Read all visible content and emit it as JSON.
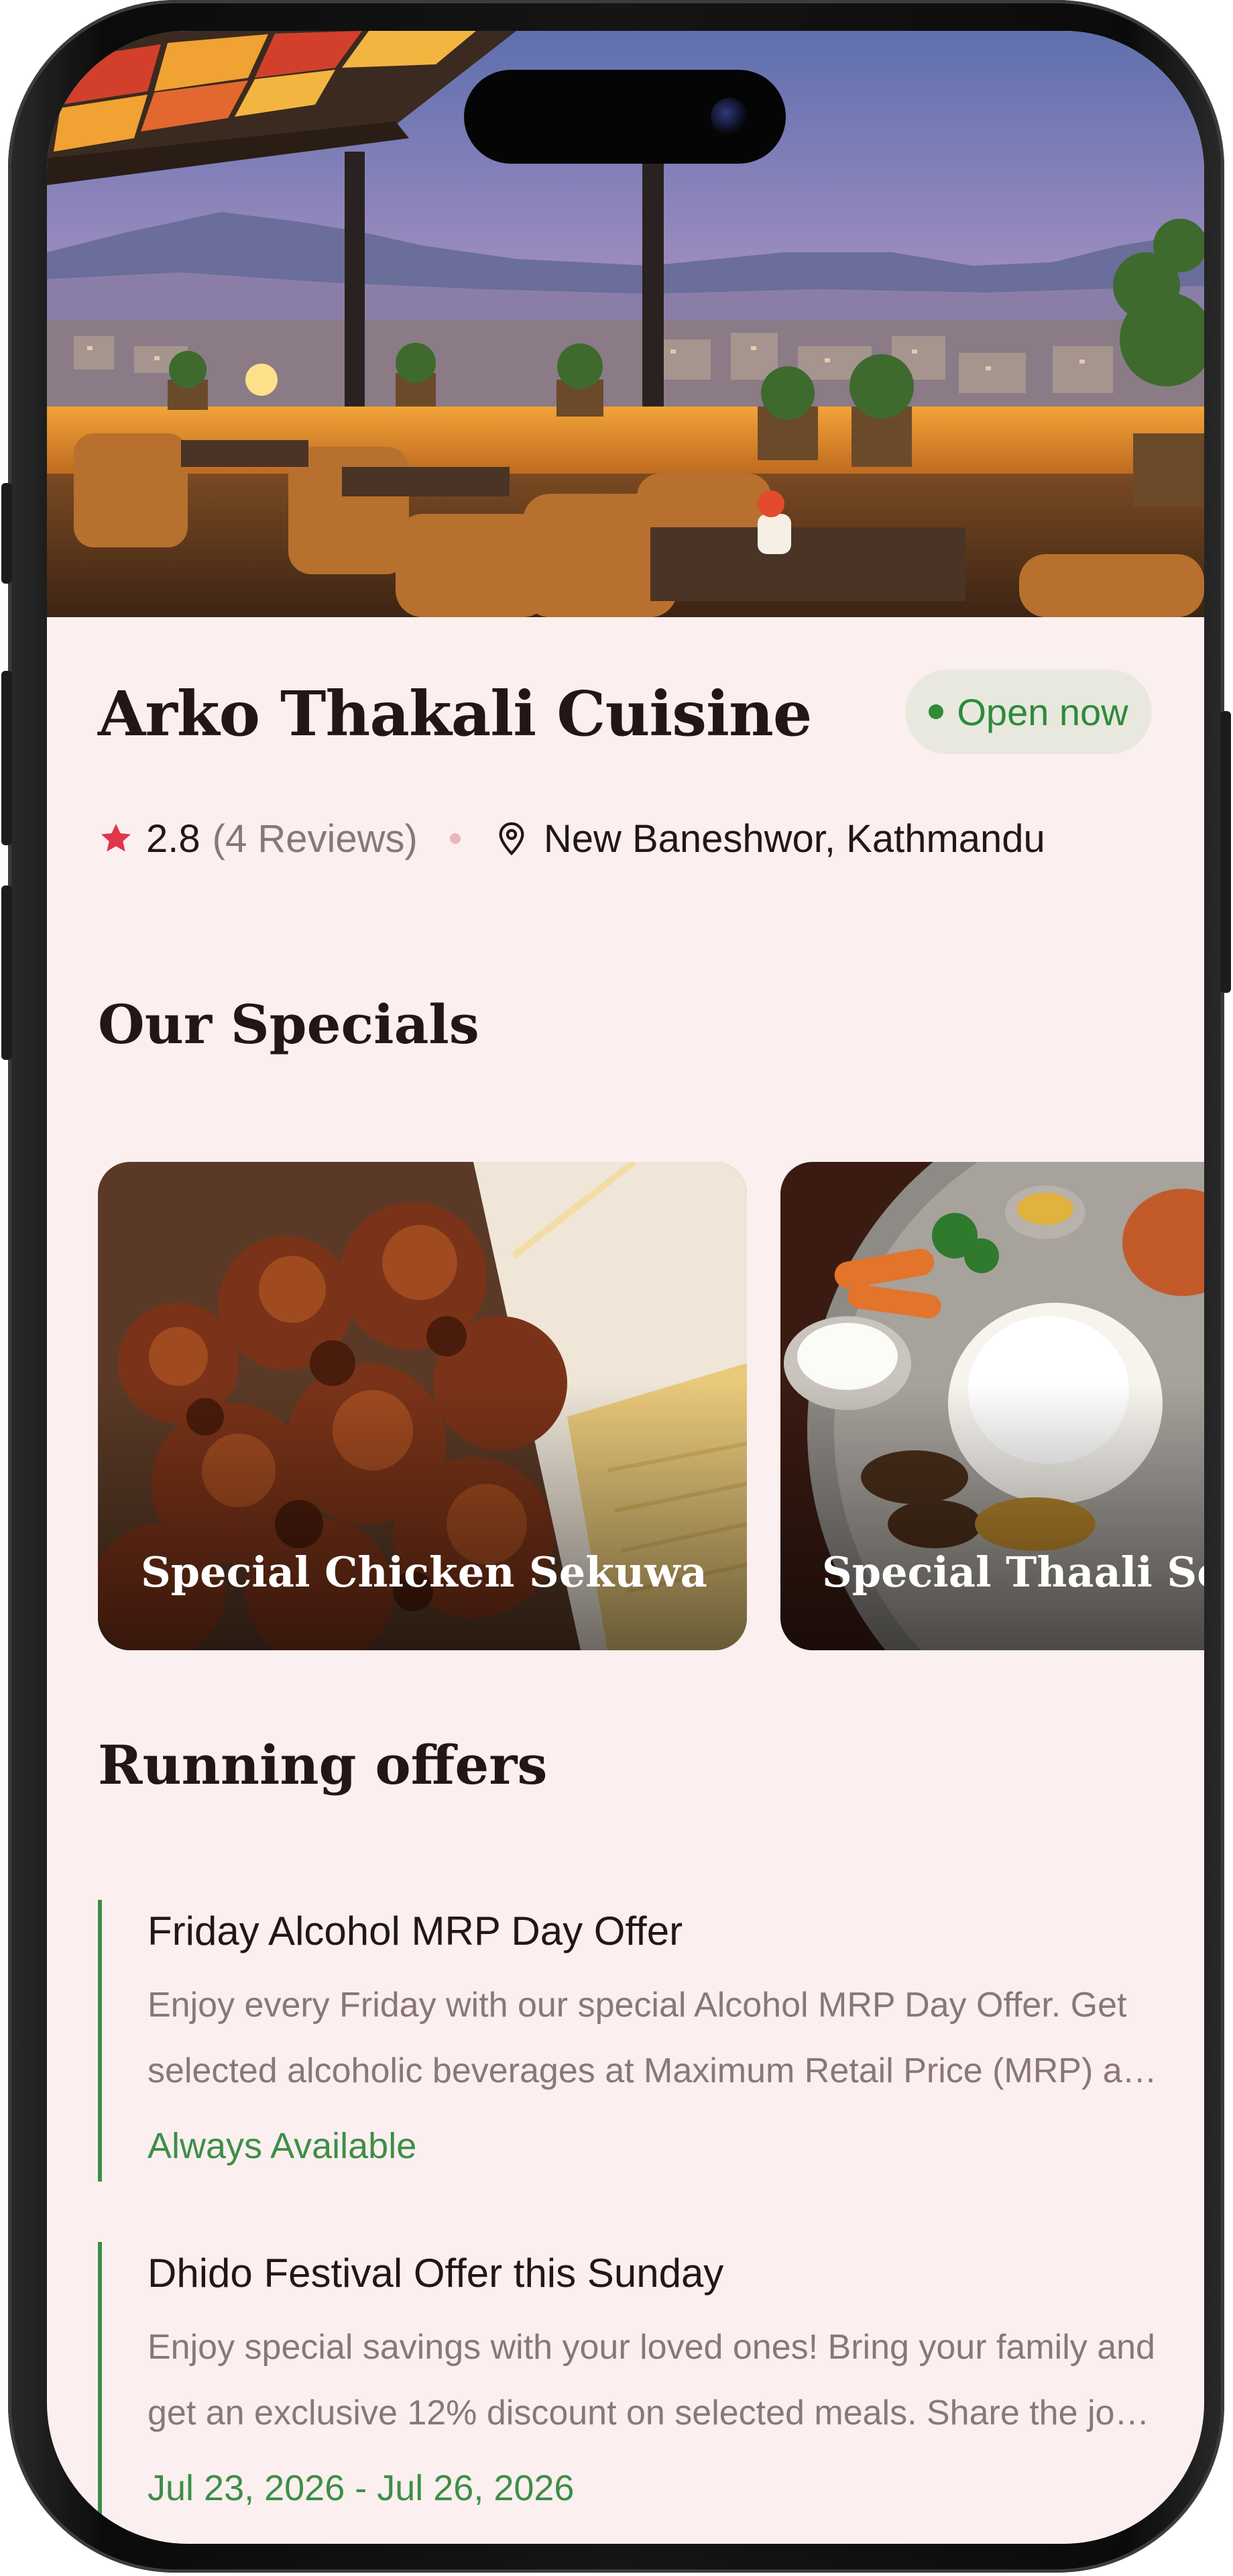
{
  "restaurant": {
    "name": "Arko Thakali Cuisine",
    "status": "Open now",
    "rating": "2.8",
    "reviews": "(4 Reviews)",
    "location": "New Baneshwor, Kathmandu"
  },
  "specials": {
    "heading": "Our Specials",
    "items": [
      {
        "label": "Special Chicken Sekuwa"
      },
      {
        "label": "Special Thaali Set"
      }
    ]
  },
  "offers": {
    "heading": "Running offers",
    "items": [
      {
        "title": "Friday Alcohol MRP Day Offer",
        "description": "Enjoy every Friday with our special Alcohol MRP Day Offer. Get selected alcoholic beverages at Maximum Retail Price (MRP) and make your weekend evenings even better.",
        "availability": "Always Available"
      },
      {
        "title": "Dhido Festival Offer this Sunday",
        "description": "Enjoy special savings with your loved ones! Bring your family and get an exclusive 12% discount on selected meals. Share the joy of authentic Thakali food.",
        "availability": "Jul 23, 2026 - Jul 26, 2026"
      }
    ]
  },
  "colors": {
    "background": "#fcefef",
    "accent_green": "#3c8f47",
    "star_red": "#e0364a",
    "text_dark": "#231716",
    "text_muted": "#8a7777"
  },
  "icons": [
    "star-icon",
    "location-pin-icon",
    "status-dot-icon"
  ]
}
